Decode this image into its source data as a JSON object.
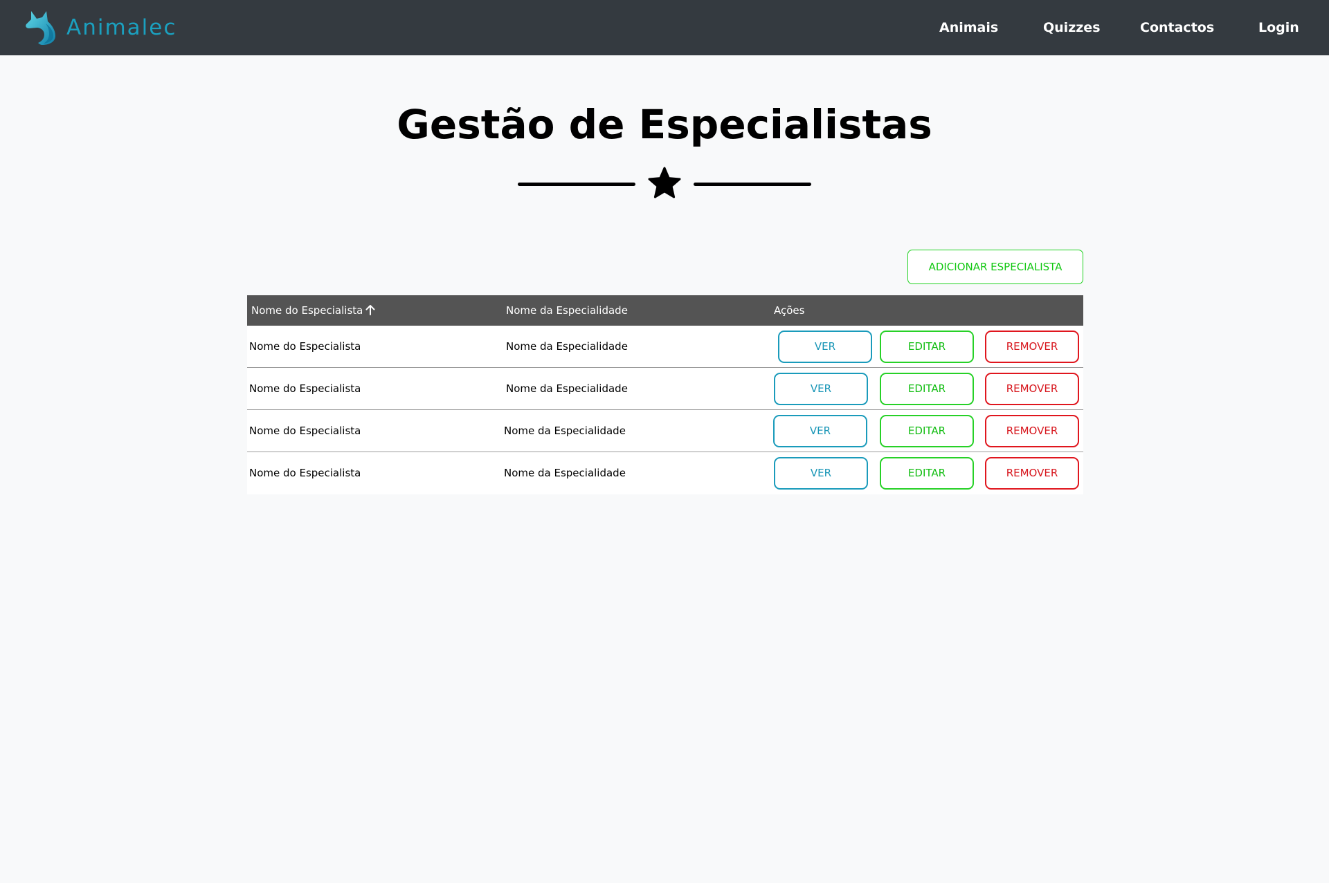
{
  "navbar": {
    "brand": "Animalec",
    "links": [
      "Animais",
      "Quizzes",
      "Contactos",
      "Login"
    ]
  },
  "header": {
    "title": "Gestão de Especialistas"
  },
  "actions": {
    "add_label": "ADICIONAR ESPECIALISTA"
  },
  "table": {
    "columns": [
      "Nome do Especialista",
      "Nome da Especialidade",
      "Ações"
    ],
    "sort": {
      "column": "Nome do Especialista",
      "direction": "ascending"
    },
    "rows": [
      {
        "name": "Nome do Especialista",
        "specialty": "Nome da Especialidade"
      },
      {
        "name": "Nome do Especialista",
        "specialty": "Nome da Especialidade"
      },
      {
        "name": "Nome do Especialista",
        "specialty": "Nome da Especialidade"
      },
      {
        "name": "Nome do Especialista",
        "specialty": "Nome da Especialidade"
      }
    ],
    "row_actions": {
      "view": "VER",
      "edit": "EDITAR",
      "remove": "REMOVER"
    }
  },
  "colors": {
    "navbar_bg": "#343a40",
    "brand": "#1ba0bf",
    "page_bg": "#f8f9fa",
    "table_header_bg": "#545454",
    "view": "#1795b6",
    "edit": "#12c812",
    "remove": "#d7151c"
  },
  "icons": [
    "dog-logo-icon",
    "star-icon",
    "arrow-up-icon"
  ]
}
